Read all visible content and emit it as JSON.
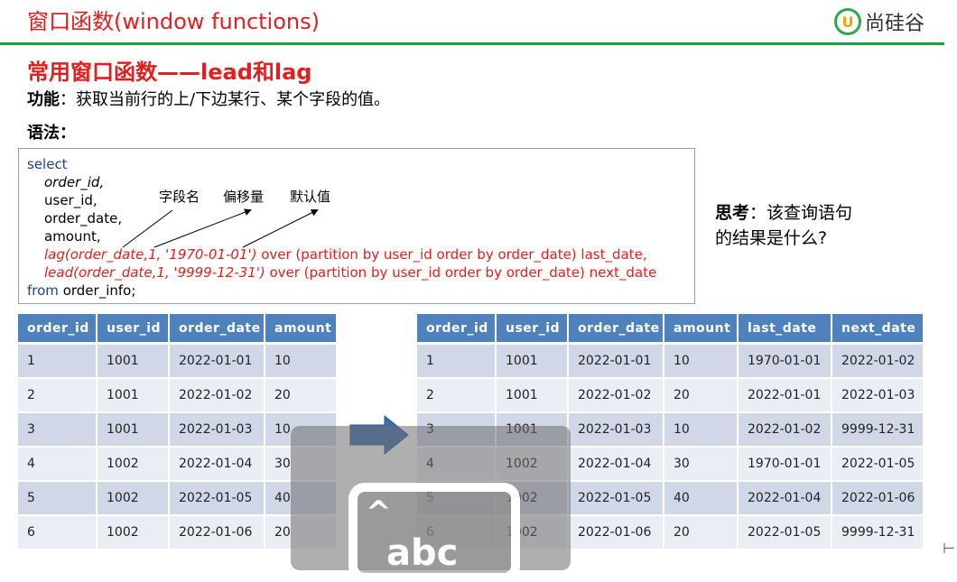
{
  "header": {
    "title": "窗口函数(window functions)",
    "logo_text": "尚硅谷",
    "logo_mark": "U"
  },
  "section_title": "常用窗口函数——lead和lag",
  "function_label": "功能",
  "function_text": "：获取当前行的上/下边某行、某个字段的值。",
  "syntax_label": "语法：",
  "code": {
    "select": "select",
    "line1": "order_id,",
    "line2": "user_id,",
    "line3": "order_date,",
    "line4": "amount,",
    "lag_fn": "lag(order_date,1, '1970-01-01')",
    "lag_rest": " over (partition by user_id order by order_date) last_date,",
    "lead_fn": "lead(order_date,1, '9999-12-31')",
    "lead_rest": " over (partition by user_id order by order_date) next_date",
    "from_kw": "from",
    "from_rest": " order_info;"
  },
  "annotations": {
    "field_name": "字段名",
    "offset": "偏移量",
    "default_value": "默认值"
  },
  "think": {
    "label": "思考",
    "line1": "：该查询语句",
    "line2": "的结果是什么?"
  },
  "left_table": {
    "headers": [
      "order_id",
      "user_id",
      "order_date",
      "amount"
    ],
    "rows": [
      [
        "1",
        "1001",
        "2022-01-01",
        "10"
      ],
      [
        "2",
        "1001",
        "2022-01-02",
        "20"
      ],
      [
        "3",
        "1001",
        "2022-01-03",
        "10"
      ],
      [
        "4",
        "1002",
        "2022-01-04",
        "30"
      ],
      [
        "5",
        "1002",
        "2022-01-05",
        "40"
      ],
      [
        "6",
        "1002",
        "2022-01-06",
        "20"
      ]
    ]
  },
  "right_table": {
    "headers": [
      "order_id",
      "user_id",
      "order_date",
      "amount",
      "last_date",
      "next_date"
    ],
    "rows": [
      [
        "1",
        "1001",
        "2022-01-01",
        "10",
        "1970-01-01",
        "2022-01-02"
      ],
      [
        "2",
        "1001",
        "2022-01-02",
        "20",
        "2022-01-01",
        "2022-01-03"
      ],
      [
        "3",
        "1001",
        "2022-01-03",
        "10",
        "2022-01-02",
        "9999-12-31"
      ],
      [
        "4",
        "1002",
        "2022-01-04",
        "30",
        "1970-01-01",
        "2022-01-05"
      ],
      [
        "5",
        "1002",
        "2022-01-05",
        "40",
        "2022-01-04",
        "2022-01-06"
      ],
      [
        "6",
        "1002",
        "2022-01-06",
        "20",
        "2022-01-05",
        "9999-12-31"
      ]
    ]
  },
  "overlay": {
    "text": "abc",
    "caret": "^"
  },
  "colors": {
    "accent_red": "#e02020",
    "rule_green": "#18a043",
    "header_blue": "#4f81bd",
    "arrow_blue": "#3a6fb0"
  },
  "icons": {
    "arrow": "right-arrow-icon",
    "edge": "edge-mark-icon"
  },
  "edge_mark": "⊢"
}
